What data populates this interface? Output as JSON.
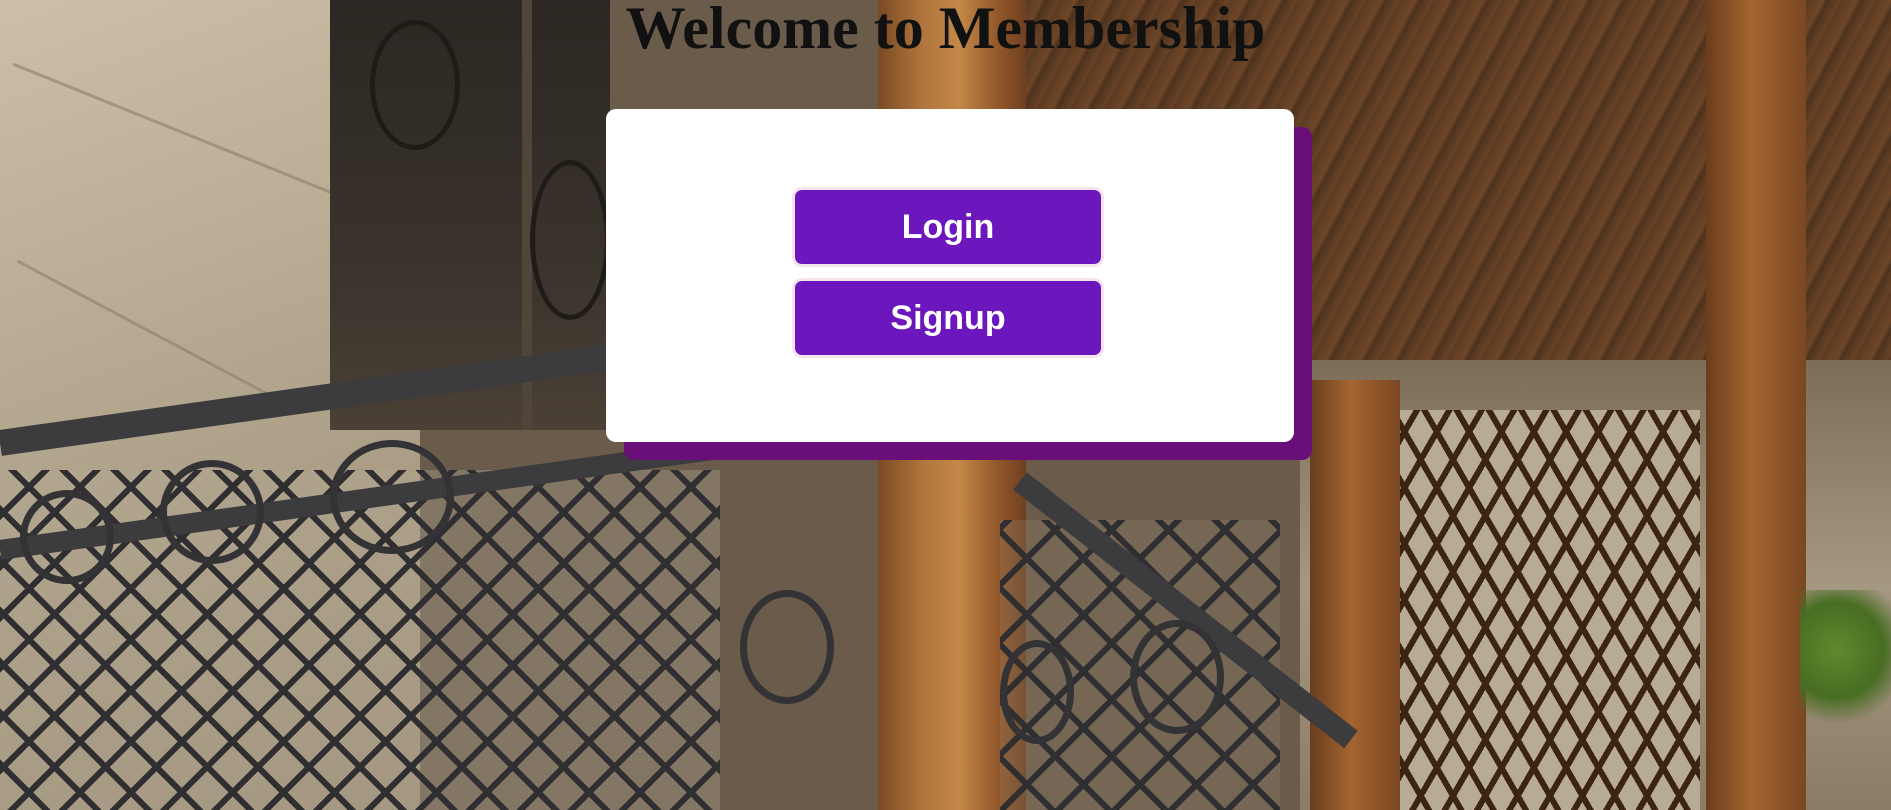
{
  "page": {
    "title": "Welcome to Membership"
  },
  "auth_card": {
    "login_label": "Login",
    "signup_label": "Signup"
  },
  "colors": {
    "button_background": "#6b17bd",
    "button_text": "#ffffff",
    "card_background": "#ffffff",
    "card_shadow": "#6a0f7a",
    "title_text": "#111111"
  },
  "background": {
    "type": "photo",
    "subject": "wrought-iron balcony railing and wooden porch beams"
  }
}
